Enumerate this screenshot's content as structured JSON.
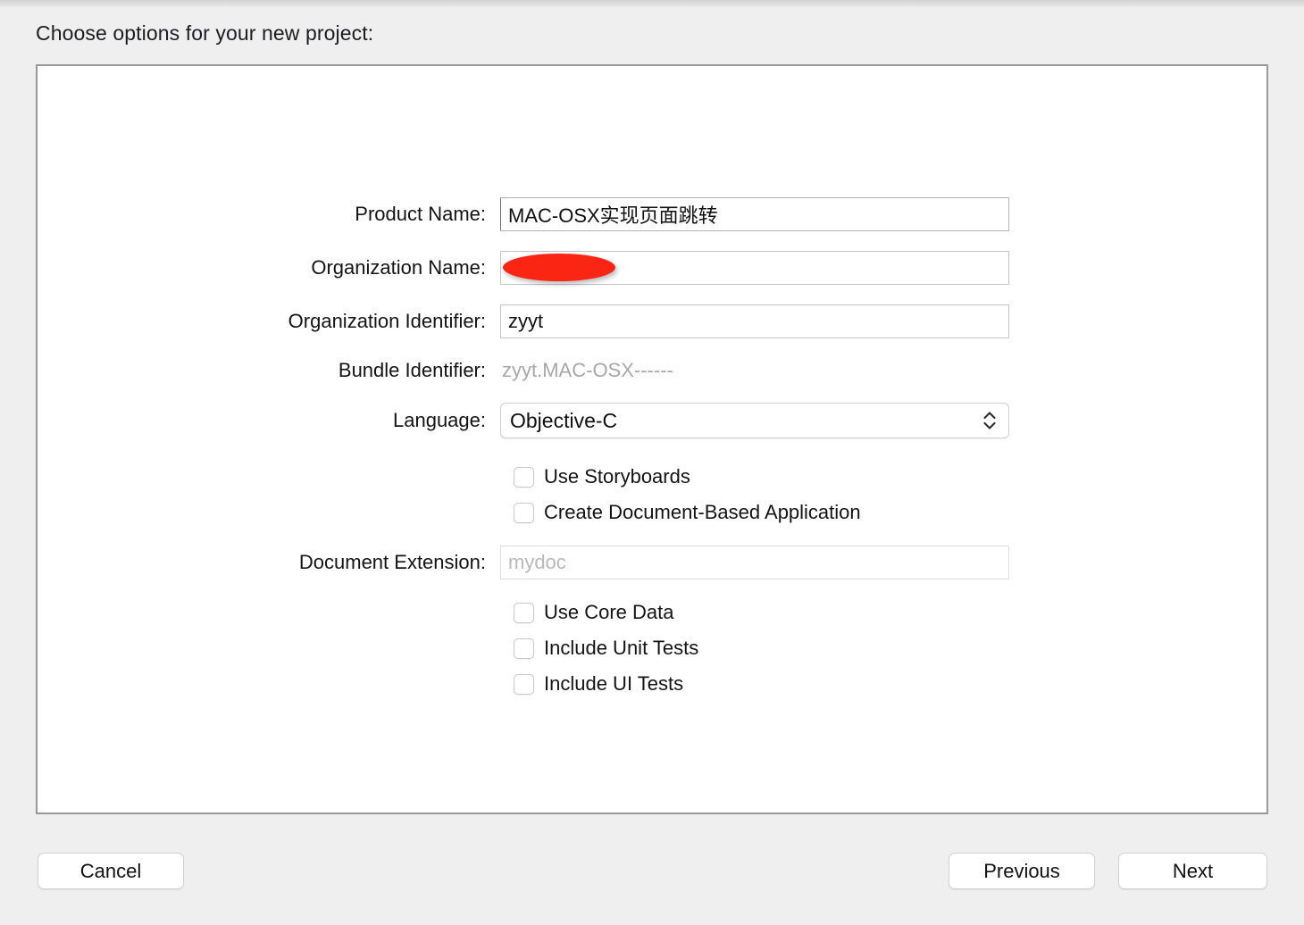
{
  "window": {
    "sheet_title": "Choose options for your new project:"
  },
  "form": {
    "fields": [
      {
        "label": "Product Name:",
        "value": "MAC-OSX实现页面跳转",
        "placeholder": "",
        "name": "product-name"
      },
      {
        "label": "Organization Name:",
        "value": "",
        "placeholder": "",
        "name": "organization-name",
        "redacted": true
      },
      {
        "label": "Organization Identifier:",
        "value": "zyyt",
        "placeholder": "",
        "name": "organization-identifier"
      },
      {
        "label": "Bundle Identifier:",
        "value": "zyyt.MAC-OSX------",
        "name": "bundle-identifier"
      },
      {
        "label": "Language:",
        "value": "Objective-C",
        "name": "language"
      },
      {
        "label": "Document Extension:",
        "value": "",
        "placeholder": "mydoc",
        "name": "document-extension"
      }
    ],
    "checkboxes_upper": [
      {
        "label": "Use Storyboards",
        "checked": false,
        "name": "use-storyboards"
      },
      {
        "label": "Create Document-Based Application",
        "checked": false,
        "name": "create-document-based-application"
      }
    ],
    "checkboxes_lower": [
      {
        "label": "Use Core Data",
        "checked": false,
        "name": "use-core-data"
      },
      {
        "label": "Include Unit Tests",
        "checked": false,
        "name": "include-unit-tests"
      },
      {
        "label": "Include UI Tests",
        "checked": false,
        "name": "include-ui-tests"
      }
    ],
    "language_options": [
      "Objective-C"
    ]
  },
  "footer": {
    "cancel_label": "Cancel",
    "previous_label": "Previous",
    "next_label": "Next"
  },
  "icons": {
    "popup_chevrons": "chevron-up-down-icon",
    "redaction": "redaction-oval"
  },
  "colors": {
    "window_background": "#efeff0",
    "panel_background": "#ffffff",
    "panel_border": "#9a9a9a",
    "redaction_red": "#fa2512",
    "placeholder_gray": "#b8b8b8",
    "static_value_gray": "#a8a8a8"
  }
}
